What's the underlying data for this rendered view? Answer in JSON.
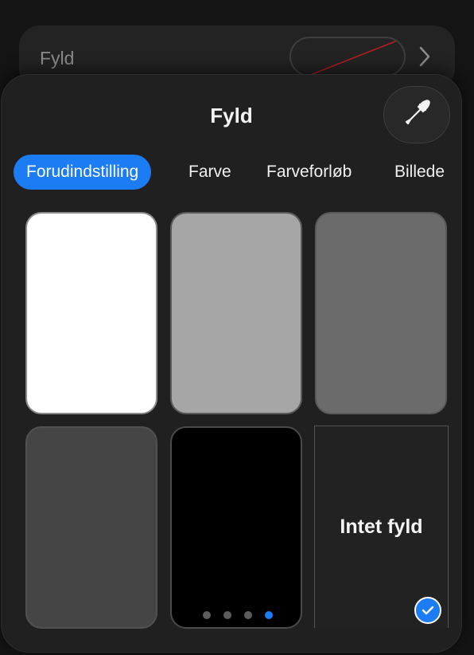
{
  "background_row": {
    "label": "Fyld",
    "chevron_icon": "chevron-right-icon"
  },
  "panel": {
    "title": "Fyld",
    "eyedropper_icon": "eyedropper-icon",
    "tabs": [
      {
        "label": "Forudindstilling",
        "active": true
      },
      {
        "label": "Farve",
        "active": false
      },
      {
        "label": "Farveforløb",
        "active": false
      },
      {
        "label": "Billede",
        "active": false
      }
    ],
    "swatches": [
      {
        "color": "#ffffff"
      },
      {
        "color": "#a6a6a6"
      },
      {
        "color": "#6b6b6b"
      },
      {
        "color": "#454545"
      },
      {
        "color": "#000000"
      }
    ],
    "no_fill": {
      "label": "Intet fyld",
      "selected": true,
      "check_icon": "checkmark-icon"
    },
    "page_dots": {
      "count": 4,
      "current": 4
    }
  },
  "colors": {
    "accent": "#1c7cf4"
  }
}
